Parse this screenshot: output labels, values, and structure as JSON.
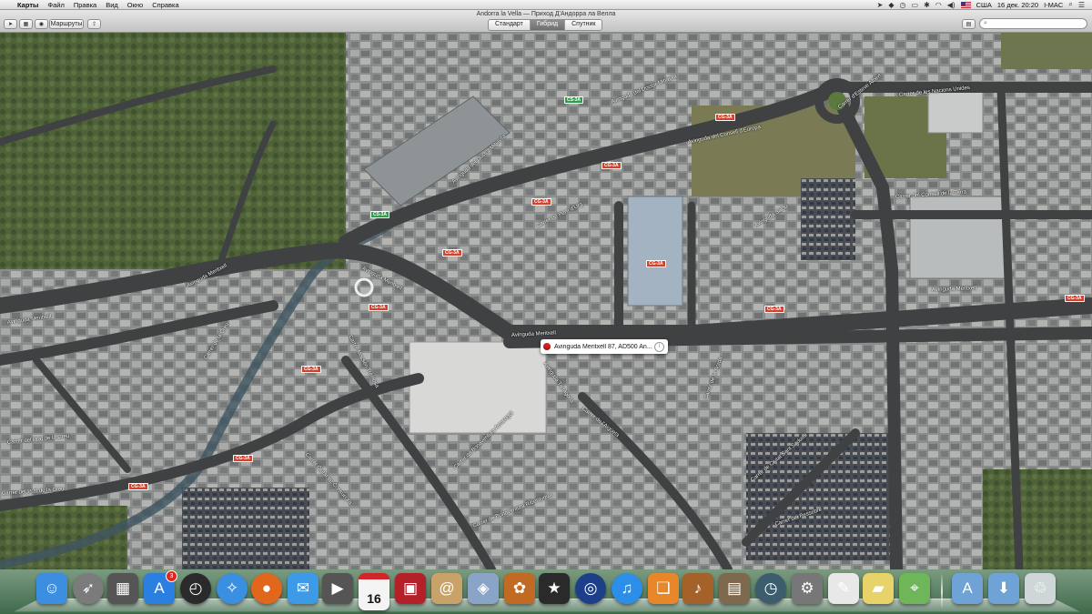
{
  "menubar": {
    "app_name": "Карты",
    "items": [
      "Файл",
      "Правка",
      "Вид",
      "Окно",
      "Справка"
    ],
    "date_time": "16 дек.  20:20",
    "user": "I-MAC",
    "input_source": "США"
  },
  "window": {
    "title": "Andorra la Vella — Приход Д'Андорра ла Велла",
    "routes_label": "Маршруты",
    "view_modes": [
      "Стандарт",
      "Гибрид",
      "Спутник"
    ],
    "active_view_mode": "Гибрид",
    "search_value": "",
    "search_placeholder": ""
  },
  "map": {
    "callout_text": "Avinguda Meritxell 87, AD500 An...",
    "zoom_out": "−",
    "zoom_in": "+",
    "streets": [
      "Avinguda del Doctor Mitjavila",
      "Avinguda del Doctor Mitjavila",
      "Avinguda del Consell d'Europa",
      "Carrer d'Esteve Albert",
      "Carrer de les Nacions Unides",
      "Carrer del Consell de la Terra",
      "Avinguda Meritxell",
      "Avinguda Meritxell",
      "Avinguda Meritxell",
      "Avinguda Meritxell",
      "Avinguda Meritxell",
      "Carrer del Prat de la Creu",
      "Carrer de la Creu",
      "Carrer del Prat de la Creu",
      "Carrer de Bonaventura Armengol",
      "Carrer de Bonaventura Riberaygua",
      "Carrer Mossèn Tremosa",
      "Carrer Ciutat de Consuegra",
      "Carrer del Pessebre",
      "Avinguda Tarragona",
      "Carrer de l'Aigüeta",
      "Avinguda Salou",
      "Carrer de la Borda",
      "Carrer de Ciutat Sant Sadurní",
      "Carrer de Pere d'Urg"
    ],
    "shields": [
      "CG-3A",
      "CG-3A",
      "CG-3A",
      "CG-3A",
      "CG-3A",
      "CG-3A",
      "CG-3A",
      "CG-3A",
      "CG-3A",
      "CG-3A",
      "CS-3A",
      "CS-3A",
      "CG-3A"
    ]
  },
  "dock": {
    "apps": [
      {
        "name": "Finder",
        "icon": "finder-icon",
        "color": "#3c8fe0"
      },
      {
        "name": "Launchpad",
        "icon": "rocket-icon",
        "color": "#7b7b7b"
      },
      {
        "name": "Mission Control",
        "icon": "mission-control-icon",
        "color": "#555"
      },
      {
        "name": "App Store",
        "icon": "app-store-icon",
        "color": "#2b7fe0",
        "badge": "3"
      },
      {
        "name": "Dashboard",
        "icon": "dashboard-icon",
        "color": "#2a2a2a"
      },
      {
        "name": "Safari",
        "icon": "safari-icon",
        "color": "#3a8fe0"
      },
      {
        "name": "Firefox",
        "icon": "firefox-icon",
        "color": "#e2661c"
      },
      {
        "name": "Messages",
        "icon": "messages-icon",
        "color": "#3c9ae6"
      },
      {
        "name": "FaceTime",
        "icon": "facetime-icon",
        "color": "#555"
      },
      {
        "name": "Calendar",
        "icon": "calendar-icon",
        "color": "#f4f4f4",
        "date": "16"
      },
      {
        "name": "Photo Booth",
        "icon": "photo-booth-icon",
        "color": "#b3202a"
      },
      {
        "name": "Contacts",
        "icon": "contacts-icon",
        "color": "#c9a26a"
      },
      {
        "name": "Preview",
        "icon": "preview-icon",
        "color": "#8aa4c7"
      },
      {
        "name": "iPhoto",
        "icon": "iphoto-icon",
        "color": "#c06a24"
      },
      {
        "name": "iMovie",
        "icon": "imovie-icon",
        "color": "#2a2a2a"
      },
      {
        "name": "DVD Player",
        "icon": "dvd-player-icon",
        "color": "#1d3f8a"
      },
      {
        "name": "iTunes",
        "icon": "itunes-icon",
        "color": "#2c8ee8"
      },
      {
        "name": "iBooks",
        "icon": "ibooks-icon",
        "color": "#e8872a"
      },
      {
        "name": "GarageBand",
        "icon": "garageband-icon",
        "color": "#a4622a"
      },
      {
        "name": "Photo Viewer",
        "icon": "photo-viewer-icon",
        "color": "#7d6a4e"
      },
      {
        "name": "Time Machine",
        "icon": "time-machine-icon",
        "color": "#3b5d6e"
      },
      {
        "name": "System Preferences",
        "icon": "system-preferences-icon",
        "color": "#777"
      },
      {
        "name": "TextEdit",
        "icon": "textedit-icon",
        "color": "#e8e8e8"
      },
      {
        "name": "Stickies",
        "icon": "stickies-icon",
        "color": "#e8d36a"
      },
      {
        "name": "Maps",
        "icon": "maps-icon",
        "color": "#6fb55a"
      },
      {
        "name": "Applications",
        "icon": "applications-folder-icon",
        "color": "#6fa3d6"
      },
      {
        "name": "Downloads",
        "icon": "downloads-folder-icon",
        "color": "#6fa3d6"
      },
      {
        "name": "Trash",
        "icon": "trash-icon",
        "color": "#cfd6d8"
      }
    ]
  }
}
